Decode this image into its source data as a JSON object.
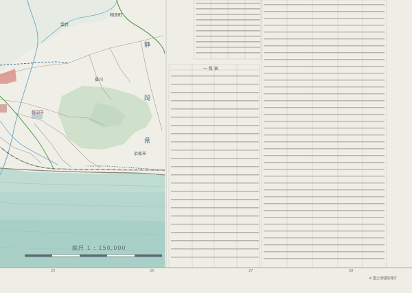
{
  "map": {
    "scale_text": "縮尺  1 : 150,000",
    "scale_ticks": [
      "0",
      "1",
      "2",
      "3",
      "4",
      "5 km"
    ],
    "footer_note": "※ 国土地理院発行",
    "places": [
      "静岡",
      "浜松市",
      "磐田市",
      "袋井",
      "相良町",
      "掛川"
    ],
    "regions": [
      "静",
      "岡",
      "県"
    ],
    "table_title": "一 覧 表",
    "grid_numbers": [
      "25",
      "26",
      "27",
      "28"
    ]
  },
  "colors": {
    "land": "#eeeee7",
    "forest": "#cfe0cb",
    "sea": "#bfdcd3",
    "sea_deep": "#a8d0c6",
    "road_main": "#9a8f7b",
    "boundary": "#3f6fa8",
    "railway": "#555555",
    "river": "#74a9c8"
  },
  "tables": {
    "rows": 24
  }
}
